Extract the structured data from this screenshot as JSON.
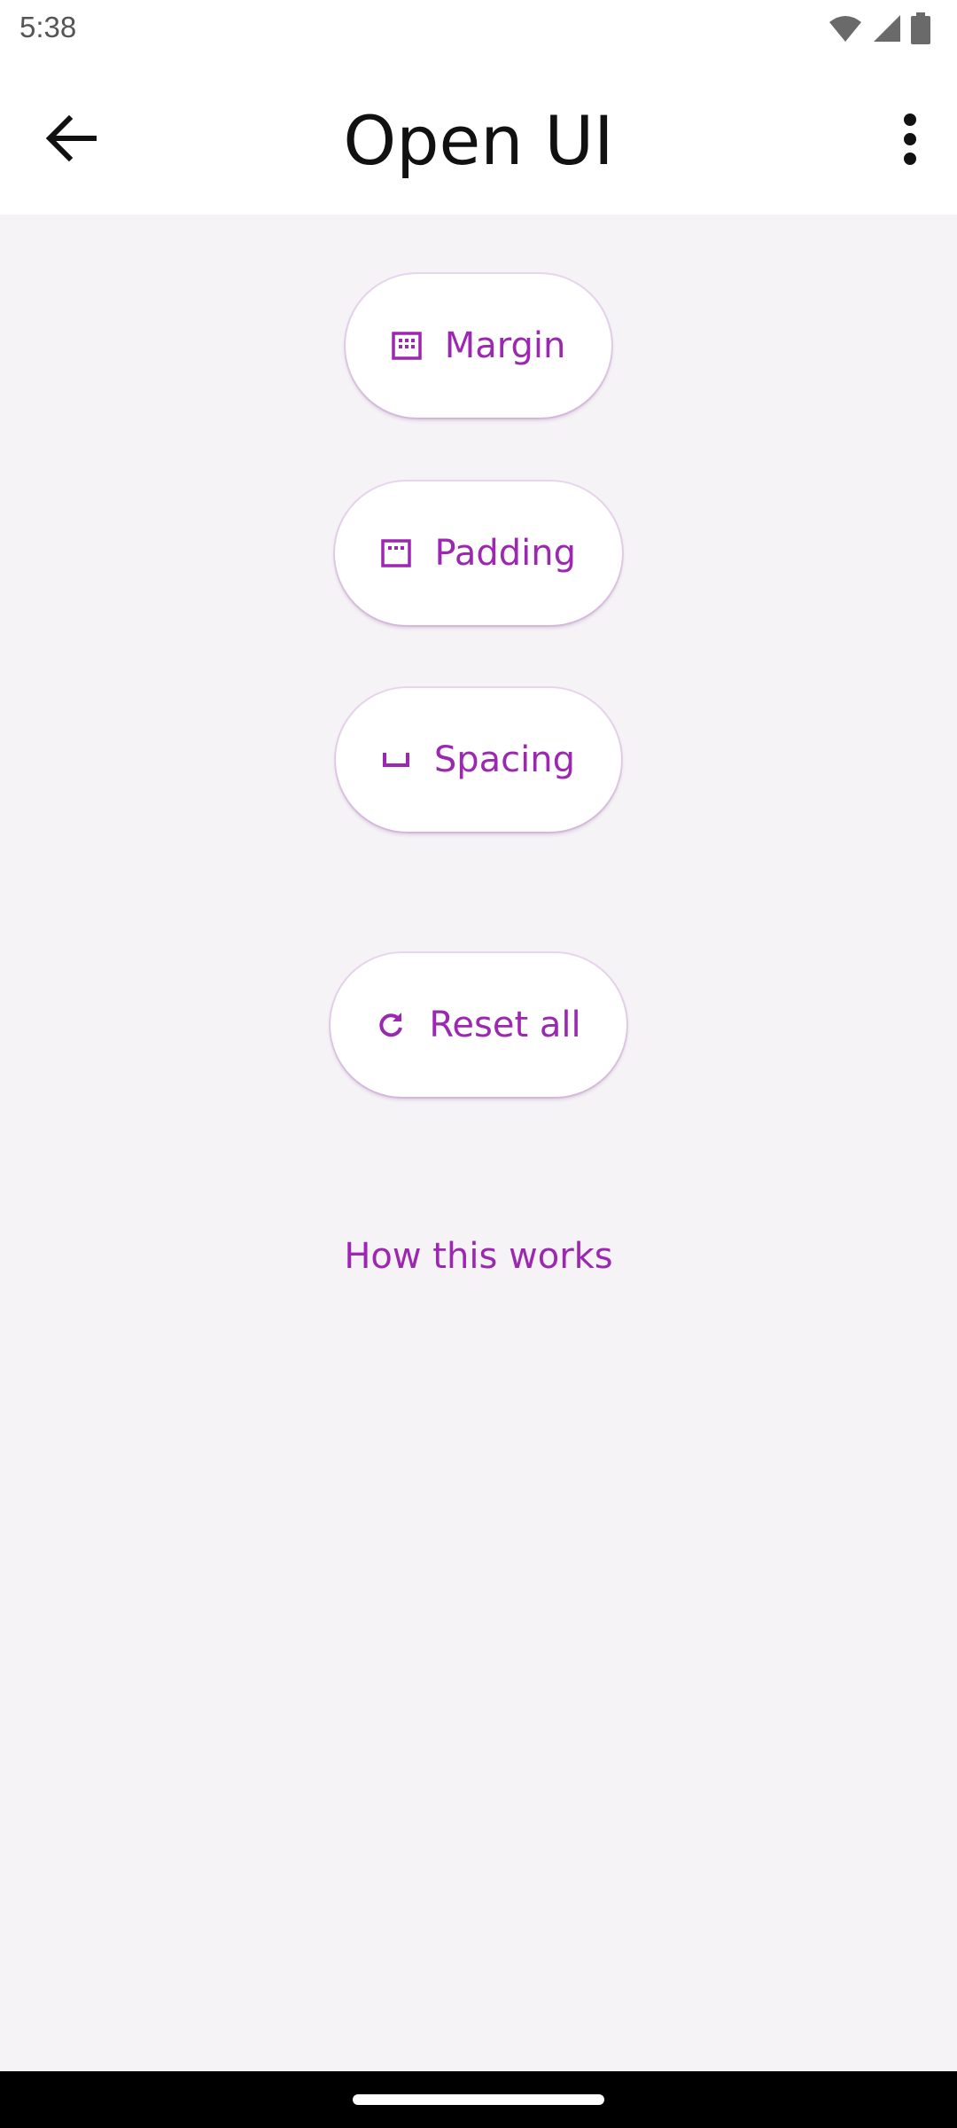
{
  "status_bar": {
    "time": "5:38",
    "icons": [
      "wifi-icon",
      "signal-icon",
      "battery-icon"
    ]
  },
  "app_bar": {
    "title": "Open UI",
    "back_icon": "arrow-back-icon",
    "overflow_icon": "more-vert-icon"
  },
  "buttons": [
    {
      "label": "Margin",
      "icon": "margin-icon"
    },
    {
      "label": "Padding",
      "icon": "padding-icon"
    },
    {
      "label": "Spacing",
      "icon": "space-bar-icon"
    },
    {
      "label": "Reset all",
      "icon": "refresh-icon"
    }
  ],
  "link": {
    "label": "How this works"
  },
  "colors": {
    "accent": "#9c27b0",
    "background": "#f5f3f6",
    "surface": "#ffffff"
  }
}
